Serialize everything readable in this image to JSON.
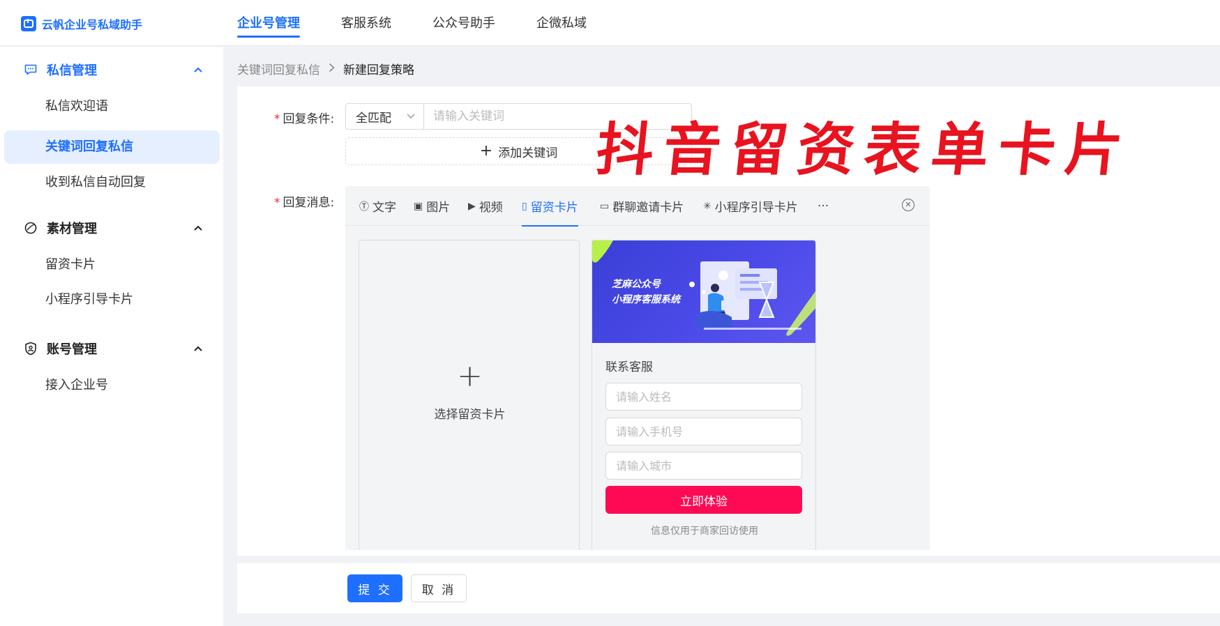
{
  "app": {
    "name": "云帆企业号私域助手",
    "logo_glyph": "帆"
  },
  "topnav": [
    {
      "label": "企业号管理",
      "active": true
    },
    {
      "label": "客服系统",
      "active": false
    },
    {
      "label": "公众号助手",
      "active": false
    },
    {
      "label": "企微私域",
      "active": false
    }
  ],
  "sidebar": {
    "groups": [
      {
        "label": "私信管理",
        "icon": "message-icon",
        "expanded": true,
        "active": true,
        "items": [
          {
            "label": "私信欢迎语",
            "active": false
          },
          {
            "label": "关键词回复私信",
            "active": true
          },
          {
            "label": "收到私信自动回复",
            "active": false
          }
        ]
      },
      {
        "label": "素材管理",
        "icon": "material-icon",
        "expanded": true,
        "active": false,
        "items": [
          {
            "label": "留资卡片",
            "active": false
          },
          {
            "label": "小程序引导卡片",
            "active": false
          }
        ]
      },
      {
        "label": "账号管理",
        "icon": "shield-icon",
        "expanded": true,
        "active": false,
        "items": [
          {
            "label": "接入企业号",
            "active": false
          }
        ]
      }
    ]
  },
  "breadcrumb": {
    "parent": "关键词回复私信",
    "separator": ">",
    "current": "新建回复策略"
  },
  "form": {
    "condition_label": "回复条件:",
    "match_mode": "全匹配",
    "keyword_placeholder": "请输入关键词",
    "add_keyword_label": "添加关键词",
    "message_label": "回复消息:",
    "required_mark": "*"
  },
  "overlay_title": "抖音留资表单卡片",
  "message_tabs": [
    {
      "label": "文字",
      "icon": "text-icon",
      "glyph": "Ⓣ",
      "active": false
    },
    {
      "label": "图片",
      "icon": "image-icon",
      "glyph": "▣",
      "active": false
    },
    {
      "label": "视频",
      "icon": "video-icon",
      "glyph": "▶",
      "active": false
    },
    {
      "label": "留资卡片",
      "icon": "lead-card-icon",
      "glyph": "▯",
      "active": true
    },
    {
      "label": "群聊邀请卡片",
      "icon": "group-invite-icon",
      "glyph": "▭",
      "active": false
    },
    {
      "label": "小程序引导卡片",
      "icon": "mini-program-icon",
      "glyph": "✳",
      "active": false
    }
  ],
  "more_tabs_glyph": "···",
  "select_card": {
    "plus": "+",
    "label": "选择留资卡片"
  },
  "preview": {
    "banner_line1": "芝麻公众号",
    "banner_line2": "小程序客服系统",
    "title": "联系客服",
    "name_placeholder": "请输入姓名",
    "phone_placeholder": "请输入手机号",
    "city_placeholder": "请输入城市",
    "button_label": "立即体验",
    "note": "信息仅用于商家回访使用"
  },
  "actions": {
    "submit": "提 交",
    "cancel": "取 消"
  },
  "colors": {
    "primary": "#1e6fff",
    "cta": "#fe0a54",
    "stamp": "#e8131e",
    "required": "#f5222d"
  }
}
